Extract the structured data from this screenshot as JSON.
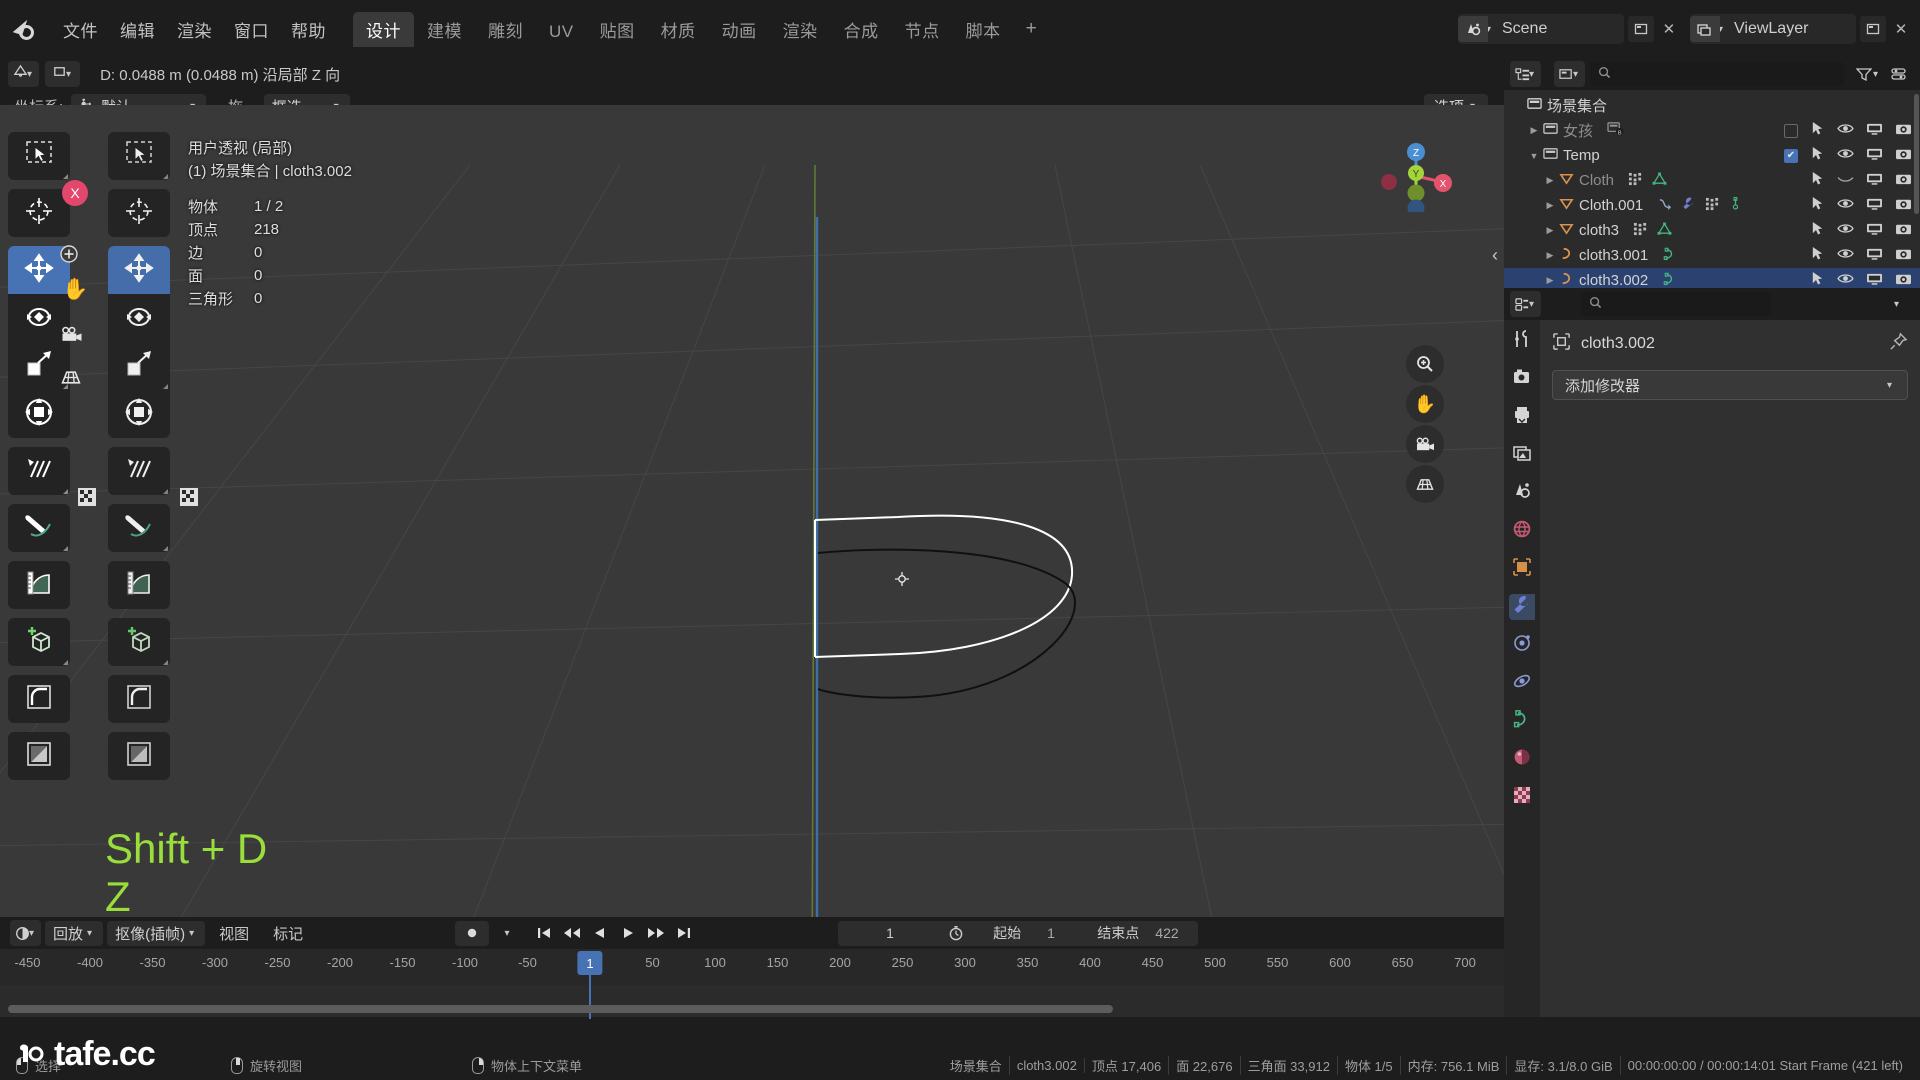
{
  "topbar": {
    "logo": "blender-logo",
    "menus": [
      "文件",
      "编辑",
      "渲染",
      "窗口",
      "帮助"
    ],
    "workspaces": [
      {
        "label": "设计",
        "active": true
      },
      {
        "label": "建模",
        "active": false
      },
      {
        "label": "雕刻",
        "active": false
      },
      {
        "label": "UV",
        "active": false
      },
      {
        "label": "贴图",
        "active": false
      },
      {
        "label": "材质",
        "active": false
      },
      {
        "label": "动画",
        "active": false
      },
      {
        "label": "渲染",
        "active": false
      },
      {
        "label": "合成",
        "active": false
      },
      {
        "label": "节点",
        "active": false
      },
      {
        "label": "脚本",
        "active": false
      }
    ],
    "add_workspace": "+",
    "scene_name": "Scene",
    "viewlayer_name": "ViewLayer",
    "scene_icon": "scene-icon",
    "viewlayer_icon": "viewlayer-icon",
    "pin_icon": "pin-icon",
    "copy_icon": "new-scene-icon",
    "delete_icon": "x-icon"
  },
  "viewport_header": {
    "editor_type_icon": "editor-type-3dview-icon",
    "mode_icon": "object-mode-icon",
    "operator_status": "D: 0.0488 m (0.0488 m) 沿局部 Z 向"
  },
  "tool_settings": {
    "transform_label": "坐标系:",
    "transform_value": "默认",
    "transform_icon": "orientation-icon",
    "drag_label": "拖...",
    "drag_value": "框选",
    "options_label": "选项",
    "options_caret": "chevron-down-icon"
  },
  "viewport": {
    "view_name": "用户透视 (局部)",
    "collection_path": "(1) 场景集合 | cloth3.002",
    "stats": [
      {
        "key": "物体",
        "value": "1 / 2"
      },
      {
        "key": "顶点",
        "value": "218"
      },
      {
        "key": "边",
        "value": "0"
      },
      {
        "key": "面",
        "value": "0"
      },
      {
        "key": "三角形",
        "value": "0"
      }
    ],
    "key_hint_line1": "Shift + D",
    "key_hint_line2": "Z",
    "key_hint_color": "#9ade3b",
    "mouse_glyph": "mouse-icon",
    "gizmo_axes": [
      "Z",
      "Y",
      "X"
    ],
    "nav_buttons": [
      "zoom-icon",
      "hand-icon",
      "camera-icon",
      "grid-ortho-icon"
    ],
    "collapse_icon": "chevron-left-icon"
  },
  "left_toolbar": {
    "groups": [
      [
        {
          "name": "tweak-tool",
          "icon": "select-box-cursor-icon",
          "selected": false,
          "corner": true
        }
      ],
      [
        {
          "name": "cursor-tool",
          "icon": "3d-cursor-icon",
          "selected": false,
          "corner": false
        }
      ],
      [
        {
          "name": "move-tool",
          "icon": "move-arrows-icon",
          "selected": true,
          "corner": false
        },
        {
          "name": "rotate-tool",
          "icon": "rotate-icon",
          "selected": false,
          "corner": false
        },
        {
          "name": "scale-tool",
          "icon": "scale-icon",
          "selected": false,
          "corner": true
        },
        {
          "name": "transform-tool",
          "icon": "transform-icon",
          "selected": false,
          "corner": false
        }
      ],
      [
        {
          "name": "annotate-tool",
          "icon": "annotate-line-icon",
          "selected": false,
          "corner": true
        }
      ],
      [
        {
          "name": "measure-pen-tool",
          "icon": "pen-curve-icon",
          "selected": false,
          "corner": true
        }
      ],
      [
        {
          "name": "measure-tool",
          "icon": "ruler-protractor-icon",
          "selected": false,
          "corner": false
        }
      ],
      [
        {
          "name": "add-cube-tool",
          "icon": "add-cube-icon",
          "selected": false,
          "corner": true
        }
      ],
      [
        {
          "name": "bevel-tool",
          "icon": "bevel-corner-icon",
          "selected": false,
          "corner": false
        }
      ],
      [
        {
          "name": "shade-tool",
          "icon": "shade-square-icon",
          "selected": false,
          "corner": false
        }
      ]
    ],
    "extra_icons": [
      "x-gizmo-icon",
      "add-circle-icon",
      "hand-icon",
      "camera-icon",
      "grid-icon",
      "checker-icon"
    ]
  },
  "outliner": {
    "display_mode_icon": "outliner-display-mode-icon",
    "filter_icon": "filter-icon",
    "new_collection_icon": "new-collection-icon",
    "search_placeholder": "",
    "search_icon": "search-icon",
    "rows": [
      {
        "indent": 0,
        "disclosure": "",
        "icon": "scene-collection-icon",
        "name": "场景集合",
        "dim": false,
        "extra": [],
        "right": [],
        "checkbox": null,
        "selected": false
      },
      {
        "indent": 1,
        "disclosure": "▶",
        "icon": "collection-icon",
        "name": "女孩",
        "dim": true,
        "extra": [
          "library-override-icon"
        ],
        "right": [
          "cursor-arrow-icon",
          "eye-icon",
          "monitor-icon",
          "camera-icon"
        ],
        "checkbox": "off",
        "selected": false
      },
      {
        "indent": 1,
        "disclosure": "▼",
        "icon": "collection-icon",
        "name": "Temp",
        "dim": false,
        "extra": [],
        "right": [
          "cursor-arrow-icon",
          "eye-icon",
          "monitor-icon",
          "camera-icon"
        ],
        "checkbox": "on",
        "selected": false
      },
      {
        "indent": 2,
        "disclosure": "▶",
        "icon": "mesh-object-icon",
        "name": "Cloth",
        "dim": true,
        "extra": [
          "modifier-icon",
          "mesh-data-icon"
        ],
        "right": [
          "cursor-arrow-icon",
          "eye-closed-icon",
          "monitor-icon",
          "camera-icon"
        ],
        "checkbox": null,
        "selected": false
      },
      {
        "indent": 2,
        "disclosure": "▶",
        "icon": "mesh-object-icon",
        "name": "Cloth.001",
        "dim": false,
        "extra": [
          "physics-icon",
          "wrench-icon",
          "modifier-icon",
          "vertex-group-icon"
        ],
        "right": [
          "cursor-arrow-icon",
          "eye-icon",
          "monitor-icon",
          "camera-icon"
        ],
        "checkbox": null,
        "selected": false
      },
      {
        "indent": 2,
        "disclosure": "▶",
        "icon": "mesh-object-icon",
        "name": "cloth3",
        "dim": false,
        "extra": [
          "modifier-icon",
          "mesh-data-icon"
        ],
        "right": [
          "cursor-arrow-icon",
          "eye-icon",
          "monitor-icon",
          "camera-icon"
        ],
        "checkbox": null,
        "selected": false
      },
      {
        "indent": 2,
        "disclosure": "▶",
        "icon": "curve-object-icon",
        "name": "cloth3.001",
        "dim": false,
        "extra": [
          "curve-data-icon"
        ],
        "right": [
          "cursor-arrow-icon",
          "eye-icon",
          "monitor-icon",
          "camera-icon"
        ],
        "checkbox": null,
        "selected": false
      },
      {
        "indent": 2,
        "disclosure": "▶",
        "icon": "curve-object-icon",
        "name": "cloth3.002",
        "dim": false,
        "extra": [
          "curve-data-icon"
        ],
        "right": [
          "cursor-arrow-icon",
          "eye-icon",
          "monitor-icon",
          "camera-icon"
        ],
        "checkbox": null,
        "selected": true
      }
    ]
  },
  "properties": {
    "editor_icon": "properties-editor-icon",
    "search_placeholder": "",
    "search_icon": "search-icon",
    "options_caret": "chevron-down-icon",
    "tabs": [
      {
        "name": "tool-tab",
        "icon": "tool-screwdriver-wrench-icon",
        "active": false
      },
      {
        "name": "render-tab",
        "icon": "render-camera-back-icon",
        "active": false
      },
      {
        "name": "output-tab",
        "icon": "output-printer-icon",
        "active": false
      },
      {
        "name": "viewlayer-tab",
        "icon": "viewlayer-images-icon",
        "active": false
      },
      {
        "name": "scene-tab",
        "icon": "scene-cone-sphere-icon",
        "active": false
      },
      {
        "name": "world-tab",
        "icon": "world-globe-icon",
        "active": false
      },
      {
        "name": "object-tab",
        "icon": "object-orange-square-icon",
        "active": false
      },
      {
        "name": "modifier-tab",
        "icon": "wrench-icon",
        "active": true
      },
      {
        "name": "particles-tab",
        "icon": "particles-icon",
        "active": false
      },
      {
        "name": "physics-tab",
        "icon": "physics-orbit-icon",
        "active": false
      },
      {
        "name": "object-data-tab",
        "icon": "curve-data-green-icon",
        "active": false
      },
      {
        "name": "material-tab",
        "icon": "material-sphere-icon",
        "active": false
      },
      {
        "name": "texture-tab",
        "icon": "texture-checker-icon",
        "active": false
      }
    ],
    "object_icon": "object-data-icon",
    "object_name": "cloth3.002",
    "pin_icon": "pin-icon",
    "add_modifier_label": "添加修改器",
    "add_modifier_caret": "chevron-down-icon"
  },
  "timeline": {
    "editor_icon": "timeline-editor-icon",
    "menus": [
      {
        "label": "回放",
        "dropdown": true
      },
      {
        "label": "抠像(插帧)",
        "dropdown": true
      },
      {
        "label": "视图",
        "dropdown": false
      },
      {
        "label": "标记",
        "dropdown": false
      }
    ],
    "record_icon": "record-dot-icon",
    "playback_buttons": [
      "jump-start-icon",
      "prev-keyframe-icon",
      "play-reverse-icon",
      "play-icon",
      "next-keyframe-icon",
      "jump-end-icon"
    ],
    "current_frame": "1",
    "clock_icon": "clock-icon",
    "start_label": "起始",
    "start_value": "1",
    "end_label": "结束点",
    "end_value": "422",
    "ticks": [
      "-450",
      "-400",
      "-350",
      "-300",
      "-250",
      "-200",
      "-150",
      "-100",
      "-50",
      "50",
      "100",
      "150",
      "200",
      "250",
      "300",
      "350",
      "400",
      "450",
      "500",
      "550",
      "600",
      "650",
      "700"
    ],
    "playhead_label": "1"
  },
  "statusbar": {
    "hints": [
      {
        "mouse": "lmb",
        "label": "选择"
      },
      {
        "mouse": "mmb",
        "label": "旋转视图"
      },
      {
        "mouse": "rmb",
        "label": "物体上下文菜单"
      }
    ],
    "stats": [
      "场景集合",
      "cloth3.002",
      "顶点 17,406",
      "面 22,676",
      "三角面 33,912",
      "物体 1/5",
      "内存: 756.1 MiB",
      "显存: 3.1/8.0 GiB",
      "00:00:00:00 / 00:00:14:01  Start Frame (421 left)"
    ]
  },
  "watermark": {
    "text": "tafe.cc",
    "icon": "tafe-logo-icon"
  },
  "colors": {
    "accent_blue": "#4772b3",
    "viewport_bg": "#393939",
    "panel_bg": "#303030",
    "header_bg": "#1d1d1d",
    "hint_green": "#9ade3b",
    "axis_x": "#e3536b",
    "axis_y": "#a3d53b",
    "axis_z": "#4a8fd4"
  }
}
